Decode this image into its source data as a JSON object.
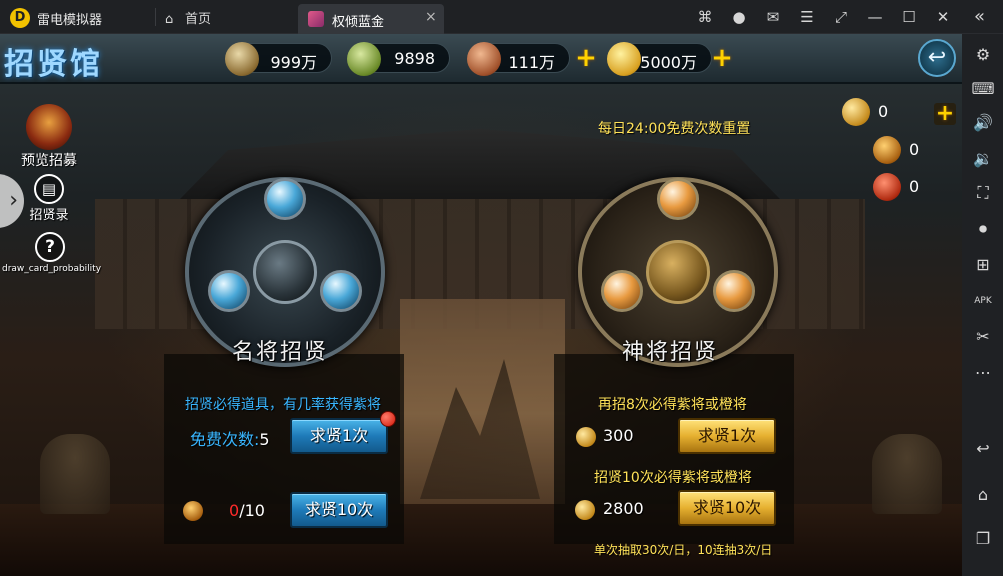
{
  "emulator": {
    "app_name": "雷电模拟器",
    "home_tab": "首页",
    "game_tab": "权倾蓝金",
    "tab_close": "×",
    "icons": [
      "gamepad-icon",
      "user-icon",
      "mail-icon",
      "menu-icon",
      "pin-icon",
      "minimize-icon",
      "maximize-icon",
      "close-icon"
    ],
    "icon_glyphs": [
      "⌘",
      "●",
      "✉",
      "☰",
      "⤢",
      "—",
      "☐",
      "✕"
    ],
    "collapse_glyph": "«"
  },
  "sidebar": {
    "items": [
      {
        "name": "settings-icon",
        "glyph": "⚙"
      },
      {
        "name": "keyboard-icon",
        "glyph": "⌨"
      },
      {
        "name": "volume-up-icon",
        "glyph": "🔊"
      },
      {
        "name": "volume-down-icon",
        "glyph": "🔉"
      },
      {
        "name": "screenshot-icon",
        "glyph": "⛶"
      },
      {
        "name": "record-icon",
        "glyph": "⏺"
      },
      {
        "name": "add-app-icon",
        "glyph": "⊞"
      },
      {
        "name": "apk-icon",
        "glyph": "APK"
      },
      {
        "name": "scissors-icon",
        "glyph": "✂"
      },
      {
        "name": "more-icon",
        "glyph": "⋯"
      },
      {
        "name": "back-nav-icon",
        "glyph": "↩"
      },
      {
        "name": "home-nav-icon",
        "glyph": "⌂"
      },
      {
        "name": "recent-apps-icon",
        "glyph": "❐"
      }
    ]
  },
  "header": {
    "title": "招贤馆",
    "resources": [
      {
        "name": "resource-silver",
        "value": "999万"
      },
      {
        "name": "resource-jade",
        "value": "9898"
      },
      {
        "name": "resource-copper",
        "value": "111万"
      },
      {
        "name": "resource-gold",
        "value": "5000万"
      }
    ],
    "back_glyph": "↩"
  },
  "left_menu": {
    "preview": "预览招募",
    "records": "招贤录",
    "probability": "draw_card_probability",
    "collapse_arrow": "›"
  },
  "currency_panel": [
    {
      "name": "token-count",
      "value": "0"
    },
    {
      "name": "general-fragment-count",
      "value": "0"
    },
    {
      "name": "divine-fragment-count",
      "value": "0"
    }
  ],
  "reset_note": "每日24:00免费次数重置",
  "famous": {
    "title": "名将招贤",
    "hint": "招贤必得道具，有几率获得紫将",
    "free_label": "免费次数:",
    "free_value": "5",
    "once_button": "求贤1次",
    "frag_current": "0",
    "frag_total": "/10",
    "ten_button": "求贤10次"
  },
  "divine": {
    "title": "神将招贤",
    "hint_once": "再招8次必得紫将或橙将",
    "cost_once": "300",
    "once_button": "求贤1次",
    "hint_ten": "招贤10次必得紫将或橙将",
    "cost_ten": "2800",
    "ten_button": "求贤10次",
    "limit_note": "单次抽取30次/日，10连抽3次/日"
  },
  "colors": {
    "accent_blue": "#39b6ff",
    "accent_gold": "#ffe259",
    "alert_red": "#ff2a2a"
  }
}
